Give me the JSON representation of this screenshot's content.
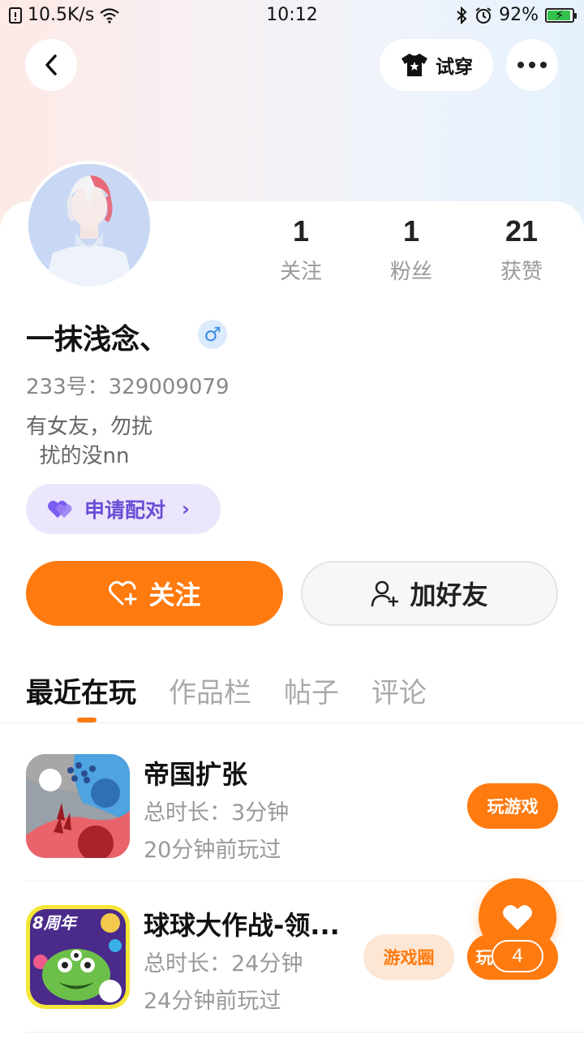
{
  "status_bar": {
    "network_speed": "10.5K/s",
    "time": "10:12",
    "battery_percent": "92%",
    "battery_level": 0.92
  },
  "header": {
    "tryon_label": "试穿"
  },
  "profile": {
    "stats": [
      {
        "value": "1",
        "label": "关注"
      },
      {
        "value": "1",
        "label": "粉丝"
      },
      {
        "value": "21",
        "label": "获赞"
      }
    ],
    "username": "一抹浅念、",
    "gender_symbol": "♂",
    "uid": "233号：329009079",
    "bio": "有女友，勿扰\n  扰的没nn",
    "pair_label": "申请配对"
  },
  "actions": {
    "follow_label": "关注",
    "add_friend_label": "加好友"
  },
  "tabs": [
    {
      "label": "最近在玩",
      "active": true
    },
    {
      "label": "作品栏",
      "active": false
    },
    {
      "label": "帖子",
      "active": false
    },
    {
      "label": "评论",
      "active": false
    }
  ],
  "games": [
    {
      "title": "帝国扩张",
      "duration": "总时长：3分钟",
      "last_played": "20分钟前玩过",
      "play_label": "玩游戏"
    },
    {
      "title": "球球大作战-领...",
      "duration": "总时长：24分钟",
      "last_played": "24分钟前玩过",
      "circle_label": "游戏圈",
      "play_label": "玩",
      "icon_badge": "8周年"
    }
  ],
  "like_fab": {
    "count": "4"
  },
  "colors": {
    "accent": "#ff7a0f",
    "pair_purple": "#6a4ed6",
    "gender_blue": "#3a8ee8"
  }
}
